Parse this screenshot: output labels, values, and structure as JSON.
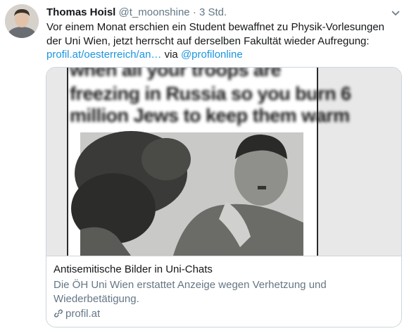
{
  "tweet": {
    "author_name": "Thomas Hoisl",
    "handle": "@t_moonshine",
    "separator": "·",
    "time": "3 Std.",
    "text_part1": "Vor einem Monat erschien ein Student bewaffnet zu Physik-Vorlesungen der Uni Wien, jetzt herrscht auf derselben Fakultät wieder Aufregung:",
    "link": "profil.at/oesterreich/an…",
    "via": "via",
    "mention": "@profilonline"
  },
  "card": {
    "image_text_lines": [
      "when all your troops are",
      "freezing in Russia so you burn 6",
      "million Jews to keep them warm"
    ],
    "title": "Antisemitische Bilder in Uni-Chats",
    "description": "Die ÖH Uni Wien erstattet Anzeige wegen Verhetzung und Wiederbetätigung.",
    "domain": "profil.at"
  },
  "icons": {
    "caret": "chevron-down-icon",
    "link": "link-icon"
  },
  "colors": {
    "link_blue": "#1b95e0",
    "secondary_text": "#657786",
    "primary_text": "#14171a",
    "border": "#ccd6dd"
  }
}
